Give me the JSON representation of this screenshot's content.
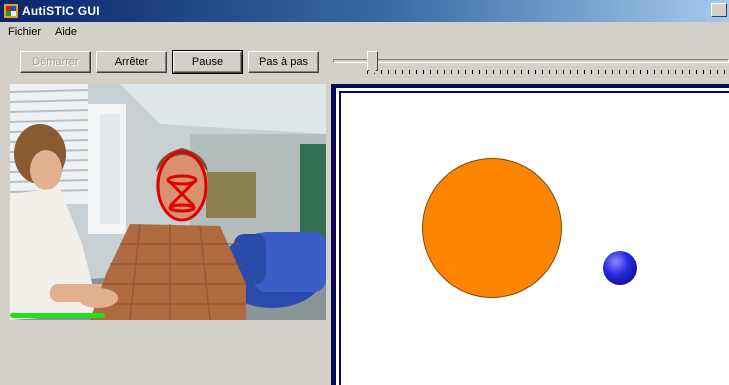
{
  "window": {
    "title": "AutiSTIC GUI"
  },
  "menu": {
    "items": [
      "Fichier",
      "Aide"
    ]
  },
  "toolbar": {
    "start_label": "Démarrer",
    "stop_label": "Arrêter",
    "pause_label": "Pause",
    "step_label": "Pas à pas",
    "speed_slider_value": 0.1
  },
  "camera": {
    "progress_level": 0.3,
    "face_overlay_color": "#e00000",
    "progress_color": "#20e020"
  },
  "game": {
    "orange_circle_color": "#ff8400",
    "blue_ball_color": "#2a2ae0"
  }
}
